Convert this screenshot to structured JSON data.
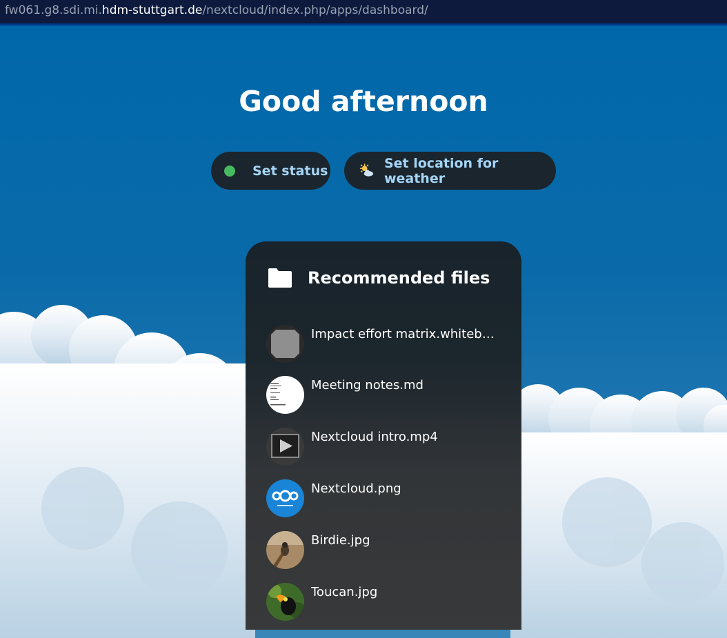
{
  "address_bar": {
    "prefix": "fw061.g8.sdi.mi.",
    "host": "hdm-stuttgart.de",
    "path": "/nextcloud/index.php/apps/dashboard/"
  },
  "greeting": "Good afternoon",
  "status_button": {
    "label": "Set status",
    "dot_color": "#46ba61"
  },
  "weather_button": {
    "label": "Set location for weather",
    "icon": "partly-sunny-icon"
  },
  "recommended": {
    "title": "Recommended files",
    "icon": "folder-icon",
    "files": [
      {
        "name": "Impact effort matrix.whiteboard",
        "thumb": "whiteboard"
      },
      {
        "name": "Meeting notes.md",
        "thumb": "document"
      },
      {
        "name": "Nextcloud intro.mp4",
        "thumb": "video"
      },
      {
        "name": "Nextcloud.png",
        "thumb": "nextcloud-logo"
      },
      {
        "name": "Birdie.jpg",
        "thumb": "bird-photo"
      },
      {
        "name": "Toucan.jpg",
        "thumb": "toucan-photo"
      }
    ]
  }
}
